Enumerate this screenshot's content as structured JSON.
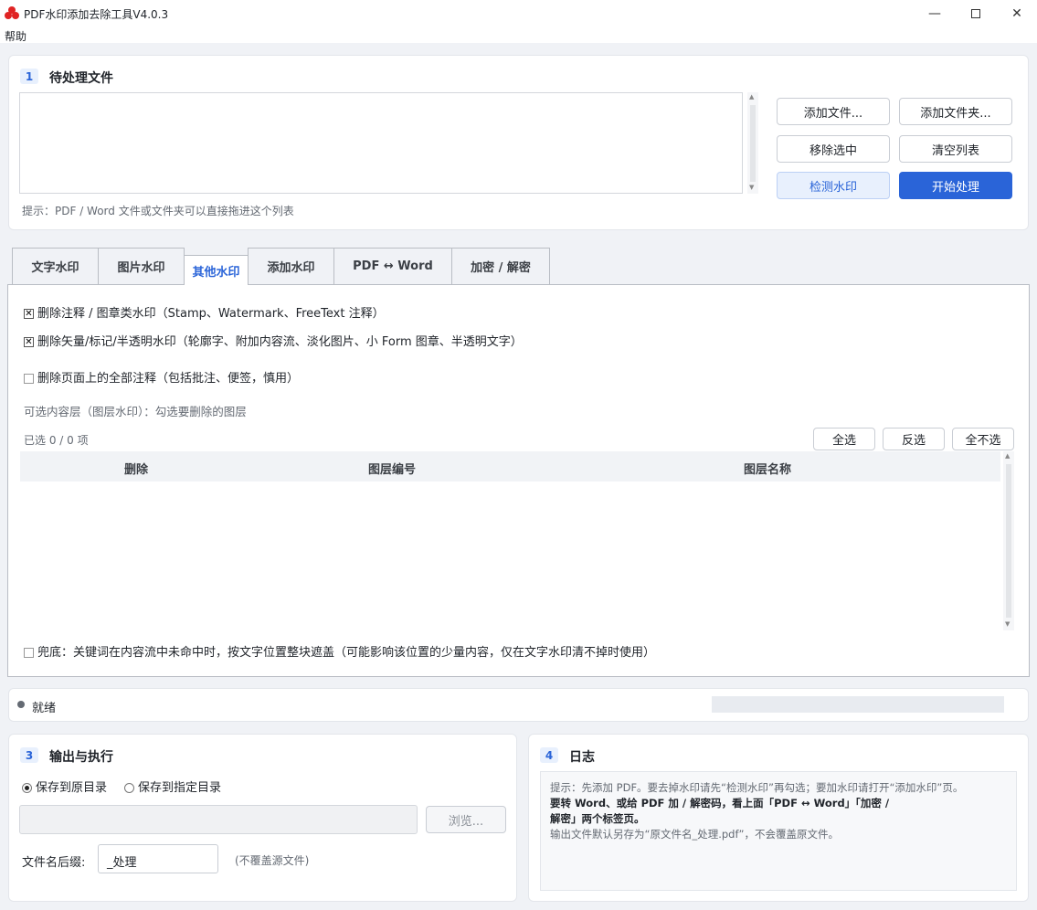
{
  "app": {
    "title": "PDF水印添加去除工具V4.0.3",
    "menu": "帮助",
    "accent": "#2a64d8"
  },
  "files": {
    "num": "1",
    "title": "待处理文件",
    "buttons": {
      "add_file": "添加文件...",
      "add_folder": "添加文件夹...",
      "remove_selected": "移除选中",
      "clear_list": "清空列表",
      "detect": "检测水印",
      "start": "开始处理"
    },
    "hint": "提示：PDF / Word 文件或文件夹可以直接拖进这个列表"
  },
  "tabs": [
    "文字水印",
    "图片水印",
    "其他水印",
    "添加水印",
    "PDF ↔ Word",
    "加密 / 解密"
  ],
  "other": {
    "opt1": "删除注释 / 图章类水印（Stamp、Watermark、FreeText 注释）",
    "opt2": "删除矢量/标记/半透明水印（轮廓字、附加内容流、淡化图片、小 Form 图章、半透明文字）",
    "opt3": "删除页面上的全部注释（包括批注、便签，慎用）",
    "layer_hint": "可选内容层（图层水印）：勾选要删除的图层",
    "selected_count": "已选 0 / 0 项",
    "select_all": "全选",
    "invert": "反选",
    "select_none": "全不选",
    "columns": [
      "删除",
      "图层编号",
      "图层名称"
    ],
    "fallback": "兜底：关键词在内容流中未命中时，按文字位置整块遮盖（可能影响该位置的少量内容，仅在文字水印清不掉时使用）"
  },
  "status": {
    "text": "就绪",
    "progress": 0
  },
  "output": {
    "num": "3",
    "title": "输出与执行",
    "radio_orig": "保存到原目录",
    "radio_custom": "保存到指定目录",
    "path_value": "",
    "browse": "浏览...",
    "suffix_label": "文件名后缀:",
    "suffix_value": "_处理",
    "suffix_note": "(不覆盖源文件)"
  },
  "log": {
    "num": "4",
    "title": "日志",
    "line1": "提示：先添加 PDF。要去掉水印请先“检测水印”再勾选；要加水印请打开“添加水印”页。",
    "line2": "要转 Word、或给 PDF 加 / 解密码，看上面「PDF ↔ Word」「加密 /",
    "line3": "解密」两个标签页。",
    "line4": "输出文件默认另存为“原文件名_处理.pdf”，不会覆盖原文件。"
  }
}
